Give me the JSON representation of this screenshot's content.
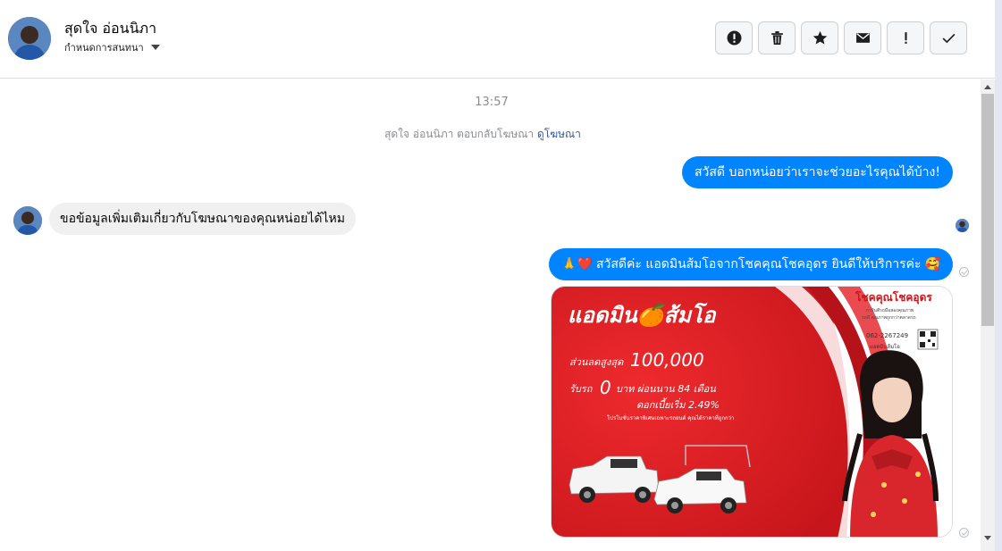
{
  "header": {
    "contact_name": "สุดใจ อ่อนนิภา",
    "assign_label": "กำหนดการสนทนา",
    "actions": [
      {
        "name": "spam-button",
        "icon": "alert-circle-icon"
      },
      {
        "name": "delete-button",
        "icon": "trash-icon"
      },
      {
        "name": "star-button",
        "icon": "star-icon"
      },
      {
        "name": "mark-unread-button",
        "icon": "envelope-icon"
      },
      {
        "name": "follow-up-button",
        "icon": "exclamation-icon"
      },
      {
        "name": "mark-done-button",
        "icon": "checkmark-icon"
      }
    ]
  },
  "chat": {
    "timestamp": "13:57",
    "system_text": "สุดใจ อ่อนนิภา ตอบกลับโฆษณา",
    "system_link": "ดูโฆษณา",
    "messages": [
      {
        "from": "page",
        "text": "สวัสดี บอกหน่อยว่าเราจะช่วยอะไรคุณได้บ้าง!"
      },
      {
        "from": "user",
        "text": "ขอข้อมูลเพิ่มเติมเกี่ยวกับโฆษณาของคุณหน่อยได้ไหม"
      },
      {
        "from": "page",
        "prefix": "🙏❤️",
        "text": "สวัสดีค่ะ แอดมินส้มโอจากโชคคุณโชคอุดร ยินดีให้บริการค่ะ",
        "suffix": "🥰"
      }
    ],
    "ad": {
      "title": "แอดมิน🍊ส้มโอ",
      "brand": "โชคคุณโชคอุดร",
      "brand_sub1": "การันตีรถมือสองคุณภาพ",
      "brand_sub2": "รถดี คุณภาพถูกกว่าตลาดรถ",
      "phone": "062-2267249",
      "line_name": "แอดมินส้มโอ",
      "discount_label": "ส่วนลดสูงสุด",
      "discount_value": "100,000",
      "down_text_a": "รับรถ",
      "down_value": "0",
      "down_text_b": "บาท ผ่อนนาน 84 เดือน",
      "interest": "ดอกเบี้ยเริ่ม 2.49%",
      "fine_print": "โปรโมชั่นราคาพิเศษเฉพาะรถยนต์ คุณได้ราคาที่ถูกกว่า"
    }
  },
  "colors": {
    "messenger_blue": "#0084ff",
    "ad_red": "#e31e24"
  }
}
